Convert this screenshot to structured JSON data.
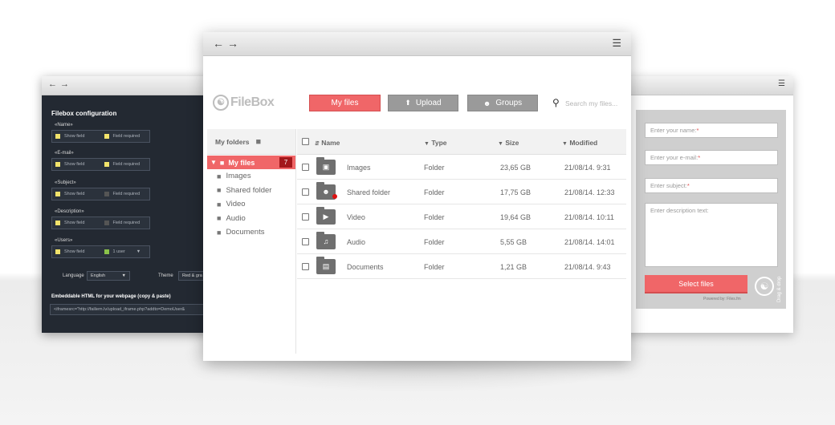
{
  "config_window": {
    "title": "Filebox configuration",
    "groups": [
      {
        "label": "«Name»",
        "left": "Show field",
        "right": "Field required",
        "left_color": "#f2e36b",
        "right_color": "#f2e36b"
      },
      {
        "label": "«E-mail»",
        "left": "Show field",
        "right": "Field required",
        "left_color": "#f2e36b",
        "right_color": "#f2e36b"
      },
      {
        "label": "«Subject»",
        "left": "Show field",
        "right": "Field required",
        "left_color": "#f2e36b",
        "right_color": "#555555"
      },
      {
        "label": "«Description»",
        "left": "Show field",
        "right": "Field required",
        "left_color": "#f2e36b",
        "right_color": "#555555"
      },
      {
        "label": "«Users»",
        "left": "Show field",
        "right": "1 user",
        "left_color": "#f2e36b",
        "right_color": "#8bc34a"
      }
    ],
    "language_label": "Language",
    "language_value": "English",
    "theme_label": "Theme",
    "theme_value": "Red & gra",
    "embed_title": "Embeddable HTML for your webpage (copy & paste)",
    "embed_code": "<iframesrc=\"http://failiem.lv/upload_iframe.php?addto=DemoUser&"
  },
  "upload_form": {
    "name_placeholder": "Enter your name:",
    "email_placeholder": "Enter your e-mail:",
    "subject_placeholder": "Enter subject:",
    "required_mark": "*",
    "description_placeholder": "Enter description text:",
    "select_button": "Select files",
    "drag_drop": "Drag & drop",
    "powered_by": "Powered by: Files.fm"
  },
  "filebox": {
    "logo_text": "FileBox",
    "buttons": {
      "my_files": "My files",
      "upload": "Upload",
      "groups": "Groups"
    },
    "search_placeholder": "Search my files...",
    "sidebar": {
      "header": "My folders",
      "active": {
        "label": "My files",
        "count": "7"
      },
      "items": [
        "Images",
        "Shared folder",
        "Video",
        "Audio",
        "Documents"
      ]
    },
    "columns": {
      "name": "Name",
      "type": "Type",
      "size": "Size",
      "modified": "Modified"
    },
    "rows": [
      {
        "name": "Images",
        "type": "Folder",
        "size": "23,65 GB",
        "modified": "21/08/14. 9:31",
        "icon": "image-folder-icon"
      },
      {
        "name": "Shared folder",
        "type": "Folder",
        "size": "17,75 GB",
        "modified": "21/08/14. 12:33",
        "icon": "shared-folder-icon"
      },
      {
        "name": "Video",
        "type": "Folder",
        "size": "19,64 GB",
        "modified": "21/08/14. 10:11",
        "icon": "video-folder-icon"
      },
      {
        "name": "Audio",
        "type": "Folder",
        "size": "5,55 GB",
        "modified": "21/08/14. 14:01",
        "icon": "audio-folder-icon"
      },
      {
        "name": "Documents",
        "type": "Folder",
        "size": "1,21 GB",
        "modified": "21/08/14. 9:43",
        "icon": "document-folder-icon"
      }
    ],
    "accent_color": "#f06668"
  }
}
